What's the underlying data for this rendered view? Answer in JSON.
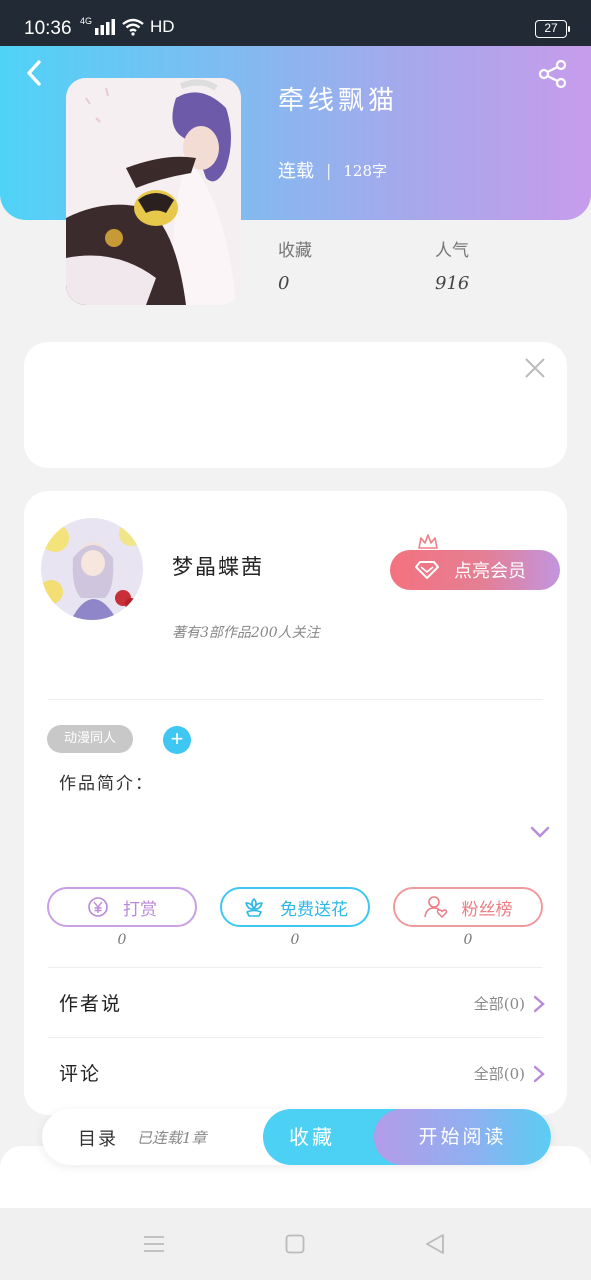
{
  "status_bar": {
    "time": "10:36",
    "network": "4G",
    "hd": "HD",
    "battery": "27"
  },
  "header": {
    "title": "牵线飘猫",
    "status": "连载",
    "separator": "|",
    "word_count": "128字",
    "stats": [
      {
        "label": "收藏",
        "value": "0"
      },
      {
        "label": "人气",
        "value": "916"
      }
    ]
  },
  "author": {
    "name": "梦晶蝶茜",
    "stats": "著有3部作品200人关注",
    "vip_label": "点亮会员"
  },
  "tag": {
    "label": "动漫同人",
    "add": "+"
  },
  "intro": {
    "label": "作品简介："
  },
  "actions": [
    {
      "label": "打赏",
      "count": "0",
      "color": "#b98ad8",
      "icon": "yen-icon"
    },
    {
      "label": "免费送花",
      "count": "0",
      "color": "#3ec7f2",
      "icon": "flower-icon"
    },
    {
      "label": "粉丝榜",
      "count": "0",
      "color": "#ef7f86",
      "icon": "fan-icon"
    }
  ],
  "rows": [
    {
      "title": "作者说",
      "link": "全部(0)"
    },
    {
      "title": "评论",
      "link": "全部(0)"
    }
  ],
  "bottom_bar": {
    "toc": "目录",
    "chapters": "已连载1章",
    "favorite": "收藏",
    "read": "开始阅读"
  },
  "colors": {
    "accent_blue": "#4fd3f7",
    "accent_purple": "#c79cec",
    "vip_pink": "#f4727f"
  }
}
